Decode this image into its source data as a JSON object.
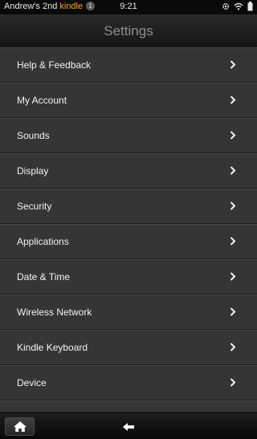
{
  "status_bar": {
    "device_name_prefix": "Andrew's 2nd ",
    "device_name_brand": "kindle",
    "notification_count": "1",
    "time": "9:21",
    "icons": [
      "gear-icon",
      "wifi-icon",
      "battery-icon"
    ]
  },
  "header": {
    "title": "Settings"
  },
  "settings": {
    "items": [
      {
        "label": "Help & Feedback"
      },
      {
        "label": "My Account"
      },
      {
        "label": "Sounds"
      },
      {
        "label": "Display"
      },
      {
        "label": "Security"
      },
      {
        "label": "Applications"
      },
      {
        "label": "Date & Time"
      },
      {
        "label": "Wireless Network"
      },
      {
        "label": "Kindle Keyboard"
      },
      {
        "label": "Device"
      }
    ]
  },
  "bottom_nav": {
    "icons": [
      "home-icon",
      "back-arrow-icon"
    ]
  },
  "colors": {
    "accent": "#f0a33a",
    "row_bg": "#353535",
    "title_text": "#8c8c8c"
  }
}
